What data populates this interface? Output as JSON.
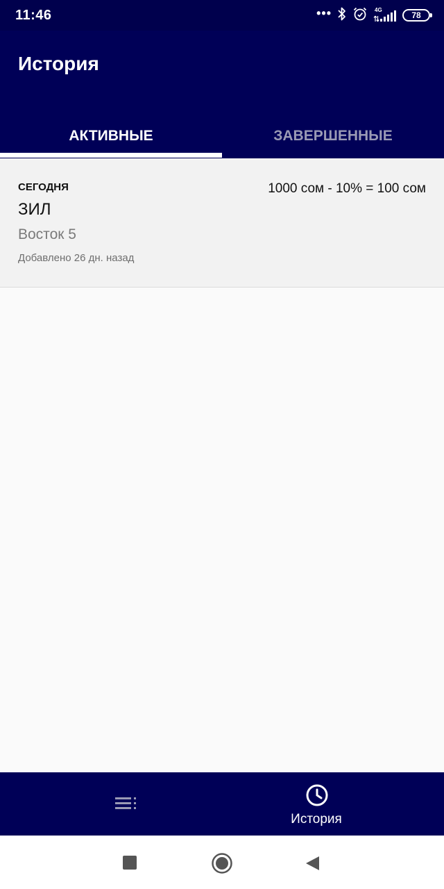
{
  "status_bar": {
    "time": "11:46",
    "dots": "•••",
    "network": "4G",
    "battery": "78",
    "icons": [
      "bluetooth-icon",
      "alarm-icon",
      "signal-icon",
      "battery-icon"
    ]
  },
  "app_bar": {
    "title": "История",
    "tabs": [
      {
        "label": "АКТИВНЫЕ",
        "active": true
      },
      {
        "label": "ЗАВЕРШЕННЫЕ",
        "active": false
      }
    ]
  },
  "orders": [
    {
      "date": "СЕГОДНЯ",
      "name": "ЗИЛ",
      "location": "Восток 5",
      "added": "Добавлено 26 дн. назад",
      "price": "1000 сом - 10% = 100 сом"
    }
  ],
  "bottom_nav": {
    "items": [
      {
        "icon": "list-icon",
        "label": ""
      },
      {
        "icon": "clock-icon",
        "label": "История",
        "active": true
      }
    ]
  },
  "system_nav": [
    "recents-icon",
    "home-icon",
    "back-icon"
  ],
  "colors": {
    "primary": "#000057",
    "status_bar": "#00004d",
    "inactive_tab": "#9a9ab5",
    "background": "#fafafa",
    "card": "#f2f2f2"
  }
}
